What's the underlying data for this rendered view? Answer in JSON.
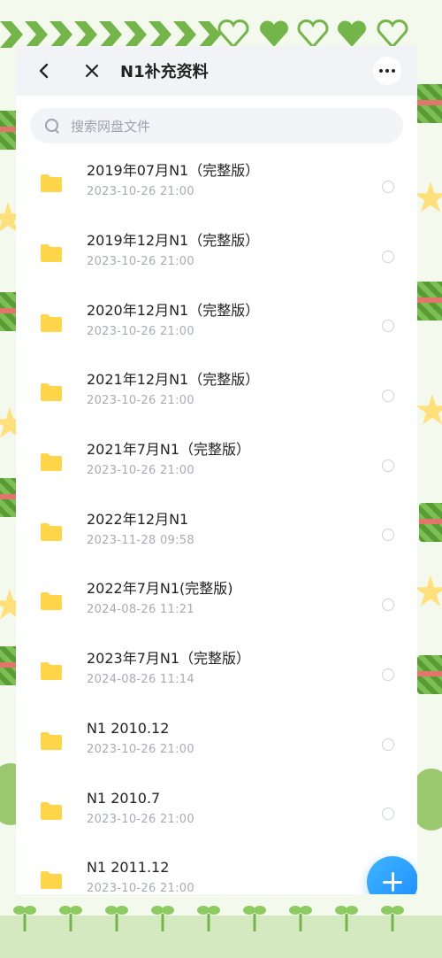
{
  "header": {
    "title": "N1补充资料",
    "back_icon": "chevron-left-icon",
    "close_icon": "close-icon",
    "more_icon": "more-horizontal-icon"
  },
  "search": {
    "placeholder": "搜索网盘文件"
  },
  "files": [
    {
      "name": "2019年07月N1（完整版）",
      "date": "2023-10-26  21:00"
    },
    {
      "name": "2019年12月N1（完整版）",
      "date": "2023-10-26  21:00"
    },
    {
      "name": "2020年12月N1（完整版）",
      "date": "2023-10-26  21:00"
    },
    {
      "name": "2021年12月N1（完整版）",
      "date": "2023-10-26  21:00"
    },
    {
      "name": "2021年7月N1（完整版）",
      "date": "2023-10-26  21:00"
    },
    {
      "name": "2022年12月N1",
      "date": "2023-11-28  09:58"
    },
    {
      "name": "2022年7月N1(完整版)",
      "date": "2024-08-26  11:21"
    },
    {
      "name": "2023年7月N1（完整版）",
      "date": "2024-08-26  11:14"
    },
    {
      "name": "N1 2010.12",
      "date": "2023-10-26  21:00"
    },
    {
      "name": "N1 2010.7",
      "date": "2023-10-26  21:00"
    },
    {
      "name": "N1 2011.12",
      "date": "2023-10-26  21:00"
    }
  ],
  "colors": {
    "folder": "#ffd54a",
    "fab": "#1d8cff",
    "theme_green": "#74b54a"
  }
}
